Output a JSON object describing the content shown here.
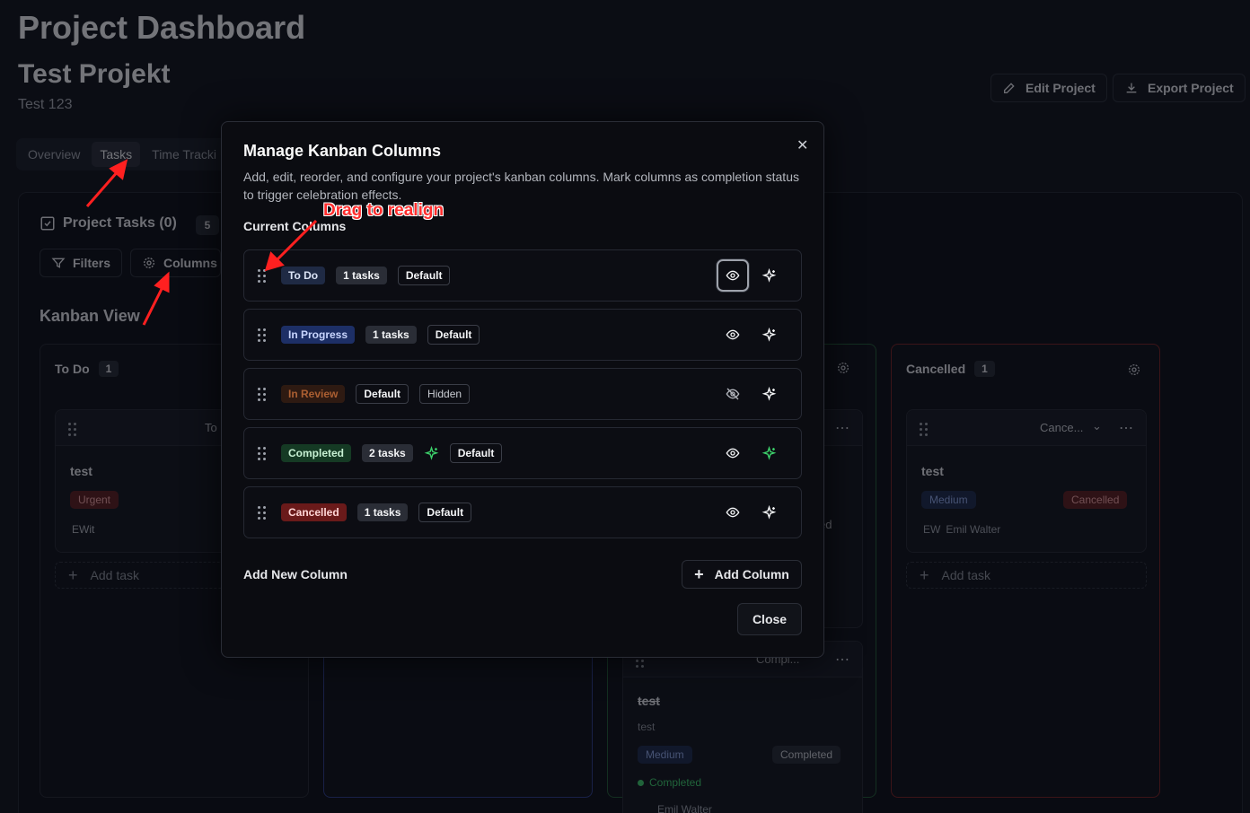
{
  "header": {
    "page_title": "Project Dashboard",
    "project_name": "Test Projekt",
    "project_desc": "Test 123",
    "edit_label": "Edit Project",
    "export_label": "Export Project"
  },
  "tabs": [
    "Overview",
    "Tasks",
    "Time Tracki"
  ],
  "tasks_panel": {
    "title": "Project Tasks (0)",
    "count": "5",
    "filters_label": "Filters",
    "columns_label": "Columns",
    "kanban_label": "Kanban View"
  },
  "board": {
    "todo": {
      "title": "To Do",
      "count": "1",
      "card_title": "test",
      "card_priority": "Urgent",
      "card_assignee": "EWit",
      "card_status": "To I",
      "add_task": "Add task"
    },
    "completed": {
      "card_status": "Compl...",
      "card_title": "test",
      "card_desc": "test",
      "card_priority": "Medium",
      "card_status_badge": "Completed",
      "card_done": "Completed",
      "card_assignee": "Emil Walter",
      "partial_text": "ed"
    },
    "cancelled": {
      "title": "Cancelled",
      "count": "1",
      "card_status": "Cance...",
      "card_title": "test",
      "card_priority": "Medium",
      "card_status_badge": "Cancelled",
      "initials": "EW",
      "assignee": "Emil Walter",
      "add_task": "Add task"
    }
  },
  "modal": {
    "title": "Manage Kanban Columns",
    "description": "Add, edit, reorder, and configure your project's kanban columns. Mark columns as completion status to trigger celebration effects.",
    "current_label": "Current Columns",
    "add_new_label": "Add New Column",
    "add_button": "Add Column",
    "close_button": "Close",
    "columns": [
      {
        "name": "To Do",
        "count": "1 tasks",
        "default": "Default",
        "visible": true,
        "color": "#1f2a44",
        "text": "#dbe3f5"
      },
      {
        "name": "In Progress",
        "count": "1 tasks",
        "default": "Default",
        "visible": true,
        "color": "#1d2f66",
        "text": "#c9d6ff"
      },
      {
        "name": "In Review",
        "default": "Default",
        "hidden": "Hidden",
        "visible": false,
        "color": "#3a1f12",
        "text": "#e07a3c"
      },
      {
        "name": "Completed",
        "count": "2 tasks",
        "default": "Default",
        "visible": true,
        "celebrate": true,
        "color": "#153a24",
        "text": "#c7f0d3"
      },
      {
        "name": "Cancelled",
        "count": "1 tasks",
        "default": "Default",
        "visible": true,
        "color": "#6a1a1a",
        "text": "#ffd6d6"
      }
    ]
  },
  "annotation": {
    "text": "Drag to realign"
  }
}
